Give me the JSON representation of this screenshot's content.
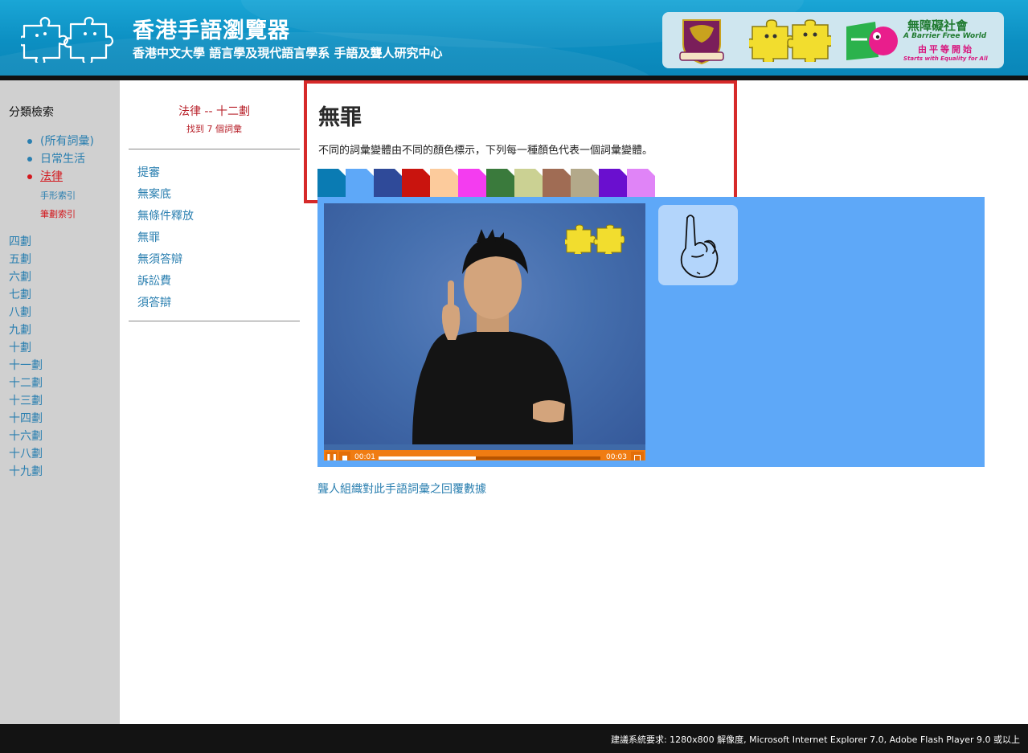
{
  "header": {
    "title": "香港手語瀏覽器",
    "subtitle": "香港中文大學 語言學及現代語言學系 手語及聾人研究中心",
    "partner": {
      "bf_line1": "無障礙社會",
      "bf_line2": "A Barrier Free World",
      "bf_line3": "由平等開始",
      "bf_line4": "Starts with Equality for All"
    }
  },
  "sidebar": {
    "title": "分類檢索",
    "categories": [
      {
        "label": "(所有詞彙)"
      },
      {
        "label": "日常生活"
      },
      {
        "label": "法律",
        "active": true
      }
    ],
    "sub_handshape": "手形索引",
    "sub_stroke": "筆劃索引",
    "strokes": [
      "四劃",
      "五劃",
      "六劃",
      "七劃",
      "八劃",
      "九劃",
      "十劃",
      "十一劃",
      "十二劃",
      "十三劃",
      "十四劃",
      "十六劃",
      "十八劃",
      "十九劃"
    ]
  },
  "word_list": {
    "title": "法律 -- 十二劃",
    "count": "找到 7 個詞彙",
    "items": [
      "提審",
      "無案底",
      "無條件釋放",
      "無罪",
      "無須答辯",
      "訴訟費",
      "須答辯"
    ]
  },
  "entry": {
    "word": "無罪",
    "variant_desc": "不同的詞彙變體由不同的顏色標示，下列每一種顏色代表一個詞彙變體。",
    "variant_colors": [
      "#0a7bb3",
      "#5ea8f8",
      "#2f4a99",
      "#c9140e",
      "#fccb9c",
      "#f43cf0",
      "#3a7a3c",
      "#cbd193",
      "#a06c54",
      "#b3a98a",
      "#6a0fcf",
      "#e084f7"
    ]
  },
  "player": {
    "time_current": "00:01",
    "time_total": "00:03",
    "progress": 0.44,
    "pause_icon": "pause-icon",
    "stop_icon": "stop-icon",
    "fullscreen_icon": "fullscreen-icon"
  },
  "feedback_link": "聾人組織對此手語詞彙之回覆數據",
  "footer": {
    "text": "建議系統要求: 1280x800 解像度, Microsoft Internet Explorer 7.0, Adobe Flash Player 9.0 或以上"
  }
}
